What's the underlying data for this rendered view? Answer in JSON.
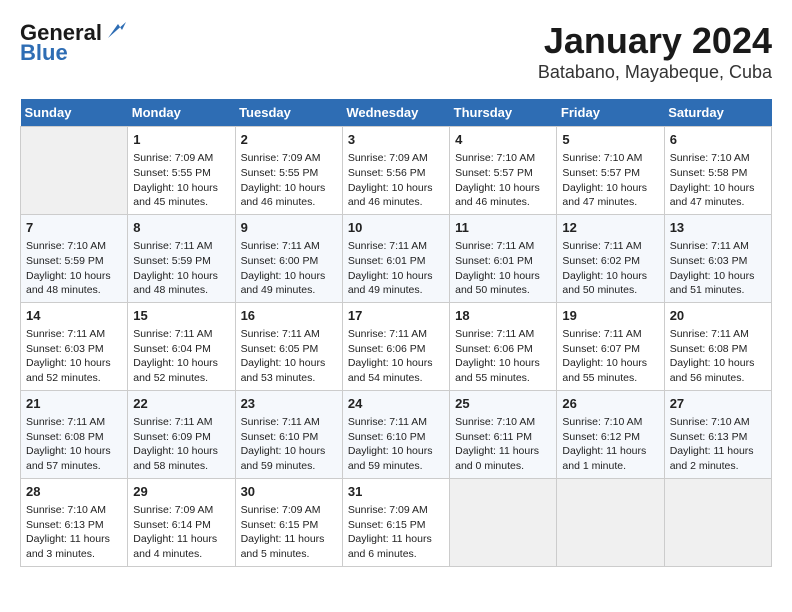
{
  "header": {
    "logo_line1": "General",
    "logo_line2": "Blue",
    "title": "January 2024",
    "subtitle": "Batabano, Mayabeque, Cuba"
  },
  "columns": [
    "Sunday",
    "Monday",
    "Tuesday",
    "Wednesday",
    "Thursday",
    "Friday",
    "Saturday"
  ],
  "weeks": [
    [
      {
        "day": "",
        "info": ""
      },
      {
        "day": "1",
        "info": "Sunrise: 7:09 AM\nSunset: 5:55 PM\nDaylight: 10 hours\nand 45 minutes."
      },
      {
        "day": "2",
        "info": "Sunrise: 7:09 AM\nSunset: 5:55 PM\nDaylight: 10 hours\nand 46 minutes."
      },
      {
        "day": "3",
        "info": "Sunrise: 7:09 AM\nSunset: 5:56 PM\nDaylight: 10 hours\nand 46 minutes."
      },
      {
        "day": "4",
        "info": "Sunrise: 7:10 AM\nSunset: 5:57 PM\nDaylight: 10 hours\nand 46 minutes."
      },
      {
        "day": "5",
        "info": "Sunrise: 7:10 AM\nSunset: 5:57 PM\nDaylight: 10 hours\nand 47 minutes."
      },
      {
        "day": "6",
        "info": "Sunrise: 7:10 AM\nSunset: 5:58 PM\nDaylight: 10 hours\nand 47 minutes."
      }
    ],
    [
      {
        "day": "7",
        "info": "Sunrise: 7:10 AM\nSunset: 5:59 PM\nDaylight: 10 hours\nand 48 minutes."
      },
      {
        "day": "8",
        "info": "Sunrise: 7:11 AM\nSunset: 5:59 PM\nDaylight: 10 hours\nand 48 minutes."
      },
      {
        "day": "9",
        "info": "Sunrise: 7:11 AM\nSunset: 6:00 PM\nDaylight: 10 hours\nand 49 minutes."
      },
      {
        "day": "10",
        "info": "Sunrise: 7:11 AM\nSunset: 6:01 PM\nDaylight: 10 hours\nand 49 minutes."
      },
      {
        "day": "11",
        "info": "Sunrise: 7:11 AM\nSunset: 6:01 PM\nDaylight: 10 hours\nand 50 minutes."
      },
      {
        "day": "12",
        "info": "Sunrise: 7:11 AM\nSunset: 6:02 PM\nDaylight: 10 hours\nand 50 minutes."
      },
      {
        "day": "13",
        "info": "Sunrise: 7:11 AM\nSunset: 6:03 PM\nDaylight: 10 hours\nand 51 minutes."
      }
    ],
    [
      {
        "day": "14",
        "info": "Sunrise: 7:11 AM\nSunset: 6:03 PM\nDaylight: 10 hours\nand 52 minutes."
      },
      {
        "day": "15",
        "info": "Sunrise: 7:11 AM\nSunset: 6:04 PM\nDaylight: 10 hours\nand 52 minutes."
      },
      {
        "day": "16",
        "info": "Sunrise: 7:11 AM\nSunset: 6:05 PM\nDaylight: 10 hours\nand 53 minutes."
      },
      {
        "day": "17",
        "info": "Sunrise: 7:11 AM\nSunset: 6:06 PM\nDaylight: 10 hours\nand 54 minutes."
      },
      {
        "day": "18",
        "info": "Sunrise: 7:11 AM\nSunset: 6:06 PM\nDaylight: 10 hours\nand 55 minutes."
      },
      {
        "day": "19",
        "info": "Sunrise: 7:11 AM\nSunset: 6:07 PM\nDaylight: 10 hours\nand 55 minutes."
      },
      {
        "day": "20",
        "info": "Sunrise: 7:11 AM\nSunset: 6:08 PM\nDaylight: 10 hours\nand 56 minutes."
      }
    ],
    [
      {
        "day": "21",
        "info": "Sunrise: 7:11 AM\nSunset: 6:08 PM\nDaylight: 10 hours\nand 57 minutes."
      },
      {
        "day": "22",
        "info": "Sunrise: 7:11 AM\nSunset: 6:09 PM\nDaylight: 10 hours\nand 58 minutes."
      },
      {
        "day": "23",
        "info": "Sunrise: 7:11 AM\nSunset: 6:10 PM\nDaylight: 10 hours\nand 59 minutes."
      },
      {
        "day": "24",
        "info": "Sunrise: 7:11 AM\nSunset: 6:10 PM\nDaylight: 10 hours\nand 59 minutes."
      },
      {
        "day": "25",
        "info": "Sunrise: 7:10 AM\nSunset: 6:11 PM\nDaylight: 11 hours\nand 0 minutes."
      },
      {
        "day": "26",
        "info": "Sunrise: 7:10 AM\nSunset: 6:12 PM\nDaylight: 11 hours\nand 1 minute."
      },
      {
        "day": "27",
        "info": "Sunrise: 7:10 AM\nSunset: 6:13 PM\nDaylight: 11 hours\nand 2 minutes."
      }
    ],
    [
      {
        "day": "28",
        "info": "Sunrise: 7:10 AM\nSunset: 6:13 PM\nDaylight: 11 hours\nand 3 minutes."
      },
      {
        "day": "29",
        "info": "Sunrise: 7:09 AM\nSunset: 6:14 PM\nDaylight: 11 hours\nand 4 minutes."
      },
      {
        "day": "30",
        "info": "Sunrise: 7:09 AM\nSunset: 6:15 PM\nDaylight: 11 hours\nand 5 minutes."
      },
      {
        "day": "31",
        "info": "Sunrise: 7:09 AM\nSunset: 6:15 PM\nDaylight: 11 hours\nand 6 minutes."
      },
      {
        "day": "",
        "info": ""
      },
      {
        "day": "",
        "info": ""
      },
      {
        "day": "",
        "info": ""
      }
    ]
  ]
}
